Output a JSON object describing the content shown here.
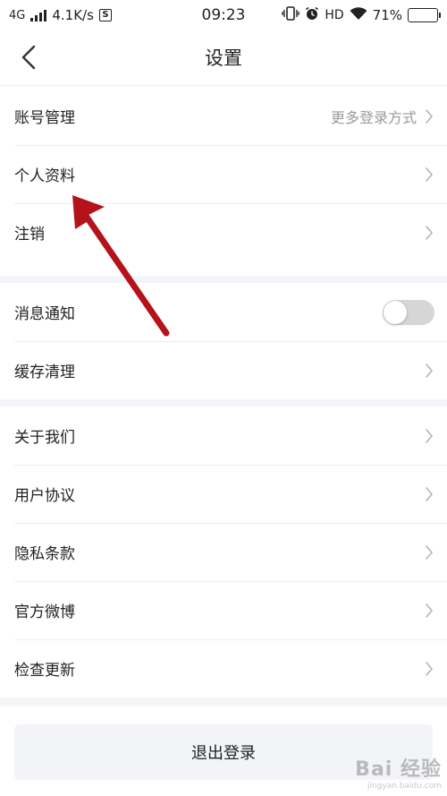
{
  "status_bar": {
    "network": "4G",
    "speed": "4.1K/s",
    "s_badge": "S",
    "time": "09:23",
    "hd": "HD",
    "battery_percent": "71%",
    "battery_level": 0.71
  },
  "header": {
    "title": "设置"
  },
  "groups": [
    {
      "rows": [
        {
          "label": "账号管理",
          "value": "更多登录方式"
        },
        {
          "label": "个人资料"
        },
        {
          "label": "注销"
        }
      ]
    },
    {
      "rows": [
        {
          "label": "消息通知",
          "toggle_on": false
        },
        {
          "label": "缓存清理"
        }
      ]
    },
    {
      "rows": [
        {
          "label": "关于我们"
        },
        {
          "label": "用户协议"
        },
        {
          "label": "隐私条款"
        },
        {
          "label": "官方微博"
        },
        {
          "label": "检查更新"
        }
      ]
    }
  ],
  "logout_label": "退出登录",
  "watermark": {
    "main": "Bai 经验",
    "sub": "jingyan.baidu.com"
  },
  "colors": {
    "annotation_arrow": "#b5121b",
    "band": "#f3f5f8",
    "toggle_off": "#d6d6d6"
  },
  "icons": {
    "back": "chevron-left-icon",
    "row_arrow": "chevron-right-icon",
    "wifi": "wifi-icon",
    "alarm": "alarm-icon",
    "vibrate": "vibrate-icon"
  }
}
